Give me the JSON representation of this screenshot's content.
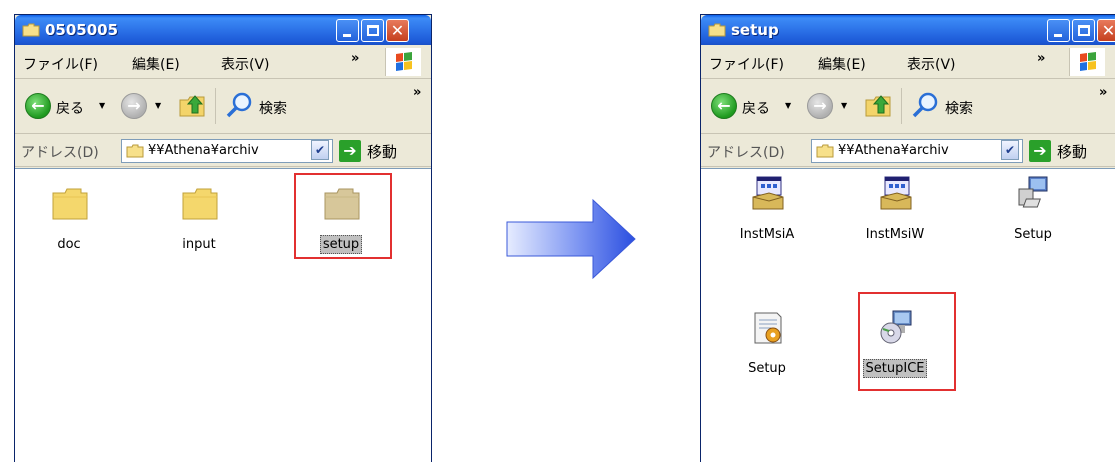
{
  "left_window": {
    "title": "0505005",
    "menu": {
      "file": "ファイル(F)",
      "edit": "編集(E)",
      "view": "表示(V)",
      "more": "»"
    },
    "toolbar": {
      "back_label": "戻る",
      "search_label": "検索",
      "more": "»"
    },
    "address": {
      "label": "アドレス(D)",
      "path": "¥¥Athena¥archiv",
      "go_label": "移動"
    },
    "items": [
      {
        "label": "doc",
        "icon": "folder-icon"
      },
      {
        "label": "input",
        "icon": "folder-icon"
      },
      {
        "label": "setup",
        "icon": "folder-icon",
        "selected": true
      }
    ]
  },
  "right_window": {
    "title": "setup",
    "menu": {
      "file": "ファイル(F)",
      "edit": "編集(E)",
      "view": "表示(V)",
      "more": "»"
    },
    "toolbar": {
      "back_label": "戻る",
      "search_label": "検索",
      "more": "»"
    },
    "address": {
      "label": "アドレス(D)",
      "path": "¥¥Athena¥archiv",
      "go_label": "移動"
    },
    "items": [
      {
        "label": "InstMsiA",
        "icon": "installer-box-icon"
      },
      {
        "label": "InstMsiW",
        "icon": "installer-box-icon"
      },
      {
        "label": "Setup",
        "icon": "setup-computer-icon"
      },
      {
        "label": "Setup",
        "icon": "setup-config-file-icon"
      },
      {
        "label": "SetupICE",
        "icon": "setup-cd-computer-icon",
        "selected": true
      }
    ]
  },
  "colors": {
    "title_blue": "#2a6fe6",
    "highlight_red": "#e23030",
    "arrow_blue": "#3f5fe0"
  }
}
